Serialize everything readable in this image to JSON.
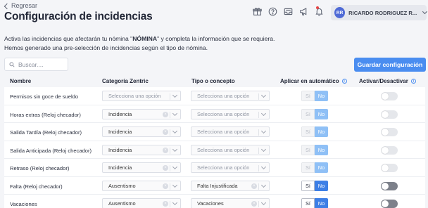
{
  "header": {
    "back_label": "Regresar",
    "title": "Configuración de incidencias",
    "user": {
      "initials": "RR",
      "name": "RICARDO RODRIGUEZ R..."
    }
  },
  "description": {
    "line1_prefix": "Activa las incidencias que afectarán tu nómina \"",
    "line1_bold": "NÓMINA",
    "line1_suffix": "\" y completa la información que se requiera.",
    "line2": "Hemos generado una pre-selección de incidencias según el tipo de nómina."
  },
  "search": {
    "placeholder": "Buscar...."
  },
  "actions": {
    "save_label": "Guardar configuración"
  },
  "columns": {
    "name": "Nombre",
    "category": "Categoría Zentric",
    "concept": "Tipo o concepto",
    "auto": "Aplicar en automático",
    "active": "Activar/Desactivar"
  },
  "rows": [
    {
      "name": "Permisos sin goce de sueldo",
      "category": "Selecciona una opción",
      "concept": "Selecciona una opción"
    },
    {
      "name": "Horas extras (Reloj checador)",
      "category": "Incidencia",
      "concept": "Selecciona una opción"
    },
    {
      "name": "Salida Tardía (Reloj checador)",
      "category": "Incidencia",
      "concept": "Selecciona una opción"
    },
    {
      "name": "Salida Anticipada (Reloj checador)",
      "category": "Incidencia",
      "concept": "Selecciona una opción"
    },
    {
      "name": "Retraso (Reloj checador)",
      "category": "Incidencia",
      "concept": "Selecciona una opción"
    },
    {
      "name": "Falta (Reloj checador)",
      "category": "Ausentismo",
      "concept": "Falta Injustificada"
    },
    {
      "name": "Vacaciones",
      "category": "Ausentismo",
      "concept": "Vacaciones"
    }
  ],
  "auto_labels": {
    "yes": "Sí",
    "no": "No"
  },
  "icons": [
    "gift-icon",
    "help-icon",
    "inbox-icon",
    "megaphone-icon",
    "bell-icon",
    "search-icon",
    "info-icon",
    "chevron-left-icon",
    "chevron-down-icon",
    "clear-icon"
  ],
  "colors": {
    "accent": "#4a8df0",
    "active_no": "#3d7fe6",
    "disabled_no": "#8fc0f6",
    "avatar": "#4f6ad6",
    "notification": "#e64545"
  }
}
